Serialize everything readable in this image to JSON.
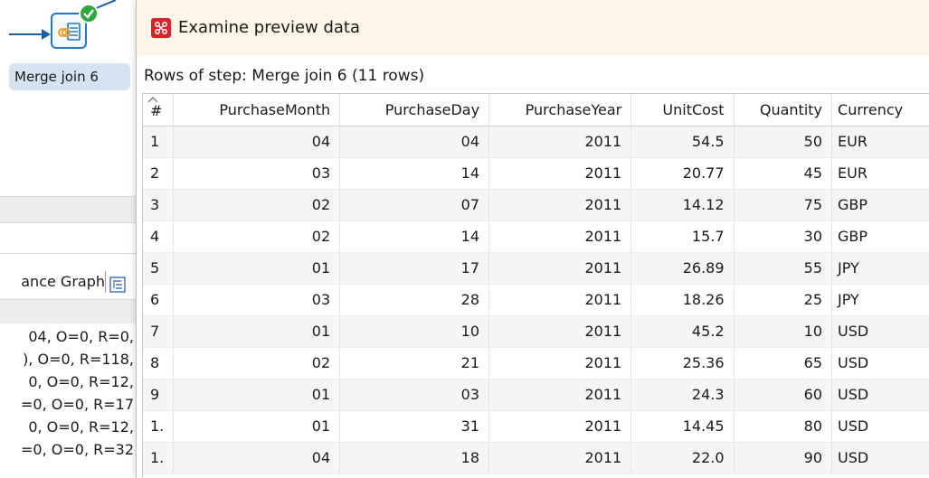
{
  "background": {
    "step_name": "Merge join 6",
    "tab_label": "ance Graph",
    "log_lines": [
      "04, O=0, R=0,",
      "), O=0, R=118,",
      "0, O=0, R=12,",
      "=0, O=0, R=17",
      "0, O=0, R=12,",
      "=0, O=0, R=32"
    ]
  },
  "dialog": {
    "title": "Examine preview data",
    "subtitle": "Rows of step: Merge join 6 (11 rows)",
    "columns": [
      "#",
      "PurchaseMonth",
      "PurchaseDay",
      "PurchaseYear",
      "UnitCost",
      "Quantity",
      "Currency"
    ],
    "rows": [
      [
        "1",
        "04",
        "04",
        "2011",
        "54.5",
        "50",
        "EUR"
      ],
      [
        "2",
        "03",
        "14",
        "2011",
        "20.77",
        "45",
        "EUR"
      ],
      [
        "3",
        "02",
        "07",
        "2011",
        "14.12",
        "75",
        "GBP"
      ],
      [
        "4",
        "02",
        "14",
        "2011",
        "15.7",
        "30",
        "GBP"
      ],
      [
        "5",
        "01",
        "17",
        "2011",
        "26.89",
        "55",
        "JPY"
      ],
      [
        "6",
        "03",
        "28",
        "2011",
        "18.26",
        "25",
        "JPY"
      ],
      [
        "7",
        "01",
        "10",
        "2011",
        "45.2",
        "10",
        "USD"
      ],
      [
        "8",
        "02",
        "21",
        "2011",
        "25.36",
        "65",
        "USD"
      ],
      [
        "9",
        "01",
        "03",
        "2011",
        "24.3",
        "60",
        "USD"
      ],
      [
        "1.",
        "01",
        "31",
        "2011",
        "14.45",
        "80",
        "USD"
      ],
      [
        "1.",
        "04",
        "18",
        "2011",
        "22.0",
        "90",
        "USD"
      ]
    ]
  },
  "colors": {
    "accent": "#1f78c8",
    "success": "#2ea63a",
    "title_icon": "#d8232a",
    "titlebar_bg": "#fbf6e7"
  },
  "icons": {
    "step": "merge-join-icon",
    "status": "check-icon",
    "dialog": "preview-data-icon",
    "tab": "tree-icon"
  }
}
